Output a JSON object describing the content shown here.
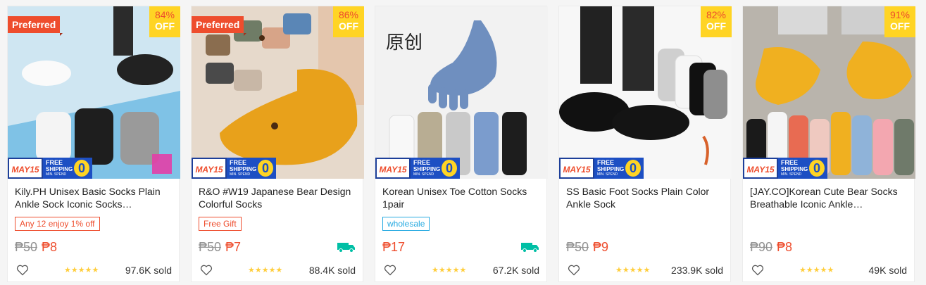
{
  "products": [
    {
      "title": "Kily.PH Unisex Basic Socks Plain Ankle Sock Iconic Socks…",
      "preferred": "Preferred",
      "discount": "84%",
      "off_label": "OFF",
      "tag": "Any 12 enjoy 1% off",
      "tag_style": "red",
      "original_price": "₱50",
      "price": "₱8",
      "free_shipping_icon": false,
      "stars": "★★★★★",
      "sold": "97.6K sold"
    },
    {
      "title": "R&O #W19 Japanese Bear Design Colorful Socks",
      "preferred": "Preferred",
      "discount": "86%",
      "off_label": "OFF",
      "tag": "Free Gift",
      "tag_style": "red",
      "original_price": "₱50",
      "price": "₱7",
      "free_shipping_icon": true,
      "stars": "★★★★★",
      "sold": "88.4K sold"
    },
    {
      "title": "Korean Unisex Toe Cotton Socks 1pair",
      "preferred": "",
      "discount": "",
      "off_label": "",
      "tag": "wholesale",
      "tag_style": "blue",
      "original_price": "",
      "price": "₱17",
      "free_shipping_icon": true,
      "stars": "★★★★★",
      "sold": "67.2K sold"
    },
    {
      "title": "SS Basic Foot Socks Plain Color Ankle Sock",
      "preferred": "",
      "discount": "82%",
      "off_label": "OFF",
      "tag": "",
      "tag_style": "",
      "original_price": "₱50",
      "price": "₱9",
      "free_shipping_icon": false,
      "stars": "★★★★★",
      "sold": "233.9K sold"
    },
    {
      "title": "[JAY.CO]Korean Cute Bear Socks Breathable Iconic Ankle…",
      "preferred": "",
      "discount": "91%",
      "off_label": "OFF",
      "tag": "",
      "tag_style": "",
      "original_price": "₱90",
      "price": "₱8",
      "free_shipping_icon": false,
      "stars": "★★★★★",
      "sold": "49K sold"
    }
  ],
  "banner": {
    "campaign": "MAY15",
    "line1": "FREE",
    "line2": "SHIPPING",
    "line3": "MIN. SPEND",
    "amount": "0"
  },
  "colors": {
    "accent": "#ee4d2d",
    "discount_bg": "#ffd424",
    "banner_blue": "#1d4fc3",
    "star": "#ffce3d"
  }
}
